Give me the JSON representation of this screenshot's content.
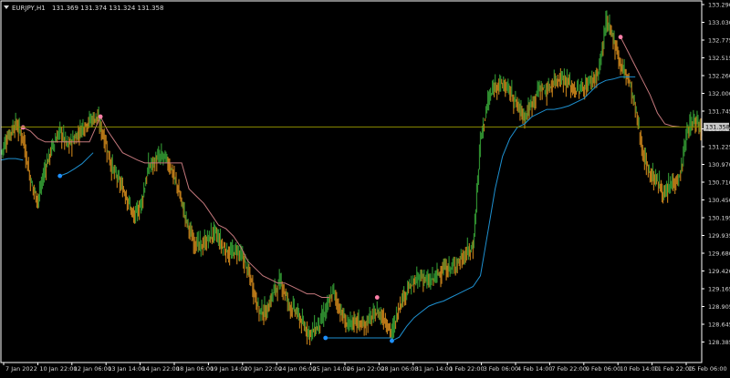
{
  "header": {
    "menu_icon": "triangle-down-icon",
    "symbol": "EURJPY,H1",
    "quote": "131.369 131.374 131.324 131.358"
  },
  "current_price_label": "131.358",
  "colors": {
    "background": "#000000",
    "frame": "#ffffff",
    "text": "#d8d8d8",
    "candle_up": "#2e8b2e",
    "candle_down": "#b87818",
    "upper_band": "#c4787c",
    "lower_band": "#1e90d0",
    "upper_marker": "#ff7fa8",
    "lower_marker": "#1e90ff",
    "price_line": "#8b8b00",
    "price_label_bg": "#c8c8c8"
  },
  "chart_data": {
    "type": "line",
    "title": "EURJPY,H1",
    "ylim": [
      128.1,
      133.1
    ],
    "grid": false,
    "y_ticks": [
      "133.290",
      "133.030",
      "132.775",
      "132.515",
      "132.260",
      "132.000",
      "131.745",
      "131.485",
      "131.225",
      "130.970",
      "130.710",
      "130.450",
      "130.195",
      "129.935",
      "129.680",
      "129.420",
      "129.165",
      "128.905",
      "128.645",
      "128.385"
    ],
    "x_ticks": [
      "7 Jan 2022",
      "10 Jan 22:00",
      "12 Jan 06:00",
      "13 Jan 14:00",
      "14 Jan 22:00",
      "18 Jan 06:00",
      "19 Jan 14:00",
      "20 Jan 22:00",
      "24 Jan 06:00",
      "25 Jan 14:00",
      "26 Jan 22:00",
      "28 Jan 06:00",
      "31 Jan 14:00",
      "1 Feb 22:00",
      "3 Feb 06:00",
      "4 Feb 14:00",
      "7 Feb 22:00",
      "9 Feb 06:00",
      "10 Feb 14:00",
      "11 Feb 22:00",
      "15 Feb 06:00"
    ],
    "current_price": 131.358,
    "series": [
      {
        "kind": "price",
        "points": [
          [
            0,
            131.0
          ],
          [
            2,
            131.25
          ],
          [
            4,
            131.4
          ],
          [
            6,
            131.2
          ],
          [
            8,
            130.6
          ],
          [
            10,
            130.35
          ],
          [
            12,
            130.8
          ],
          [
            14,
            131.1
          ],
          [
            16,
            131.3
          ],
          [
            18,
            131.1
          ],
          [
            20,
            131.2
          ],
          [
            22,
            131.35
          ],
          [
            24,
            131.45
          ],
          [
            26,
            131.5
          ],
          [
            28,
            131.2
          ],
          [
            30,
            130.8
          ],
          [
            32,
            130.6
          ],
          [
            34,
            130.4
          ],
          [
            36,
            130.1
          ],
          [
            38,
            130.3
          ],
          [
            40,
            130.8
          ],
          [
            42,
            130.9
          ],
          [
            44,
            130.95
          ],
          [
            46,
            130.8
          ],
          [
            48,
            130.5
          ],
          [
            50,
            130.1
          ],
          [
            52,
            129.8
          ],
          [
            54,
            129.7
          ],
          [
            56,
            129.8
          ],
          [
            58,
            129.9
          ],
          [
            60,
            129.7
          ],
          [
            62,
            129.6
          ],
          [
            64,
            129.65
          ],
          [
            66,
            129.5
          ],
          [
            68,
            129.2
          ],
          [
            70,
            128.8
          ],
          [
            72,
            128.8
          ],
          [
            74,
            129.1
          ],
          [
            76,
            129.2
          ],
          [
            78,
            128.9
          ],
          [
            80,
            128.8
          ],
          [
            82,
            128.6
          ],
          [
            84,
            128.5
          ],
          [
            86,
            128.6
          ],
          [
            88,
            128.8
          ],
          [
            90,
            129.1
          ],
          [
            92,
            128.8
          ],
          [
            94,
            128.6
          ],
          [
            96,
            128.7
          ],
          [
            98,
            128.6
          ],
          [
            100,
            128.7
          ],
          [
            102,
            128.8
          ],
          [
            104,
            128.7
          ],
          [
            106,
            128.5
          ],
          [
            108,
            128.9
          ],
          [
            110,
            129.1
          ],
          [
            112,
            129.2
          ],
          [
            114,
            129.3
          ],
          [
            116,
            129.2
          ],
          [
            118,
            129.3
          ],
          [
            120,
            129.4
          ],
          [
            122,
            129.4
          ],
          [
            124,
            129.5
          ],
          [
            126,
            129.6
          ],
          [
            128,
            129.7
          ],
          [
            130,
            131.2
          ],
          [
            132,
            131.7
          ],
          [
            134,
            131.95
          ],
          [
            136,
            131.95
          ],
          [
            138,
            131.85
          ],
          [
            140,
            131.65
          ],
          [
            142,
            131.5
          ],
          [
            144,
            131.7
          ],
          [
            146,
            131.9
          ],
          [
            148,
            131.85
          ],
          [
            150,
            132.0
          ],
          [
            152,
            132.05
          ],
          [
            154,
            131.95
          ],
          [
            156,
            131.85
          ],
          [
            158,
            131.9
          ],
          [
            160,
            132.0
          ],
          [
            162,
            132.1
          ],
          [
            164,
            132.8
          ],
          [
            166,
            132.6
          ],
          [
            168,
            132.2
          ],
          [
            170,
            132.05
          ],
          [
            172,
            131.6
          ],
          [
            174,
            131.0
          ],
          [
            176,
            130.7
          ],
          [
            178,
            130.6
          ],
          [
            180,
            130.4
          ],
          [
            182,
            130.6
          ],
          [
            184,
            130.65
          ],
          [
            186,
            131.3
          ],
          [
            188,
            131.45
          ],
          [
            190,
            131.36
          ]
        ]
      },
      {
        "name": "",
        "kind": "upper",
        "points": [
          [
            6,
            131.35
          ],
          [
            8,
            131.3
          ],
          [
            10,
            131.2
          ],
          [
            12,
            131.15
          ],
          [
            14,
            131.15
          ],
          [
            16,
            131.15
          ],
          [
            18,
            131.15
          ],
          [
            20,
            131.15
          ],
          [
            22,
            131.15
          ],
          [
            24,
            131.15
          ],
          [
            27,
            131.5
          ],
          [
            29,
            131.3
          ],
          [
            31,
            131.15
          ],
          [
            33,
            131.0
          ],
          [
            35,
            130.95
          ],
          [
            37,
            130.9
          ],
          [
            39,
            130.86
          ],
          [
            41,
            130.86
          ],
          [
            43,
            130.86
          ],
          [
            45,
            130.86
          ],
          [
            47,
            130.86
          ],
          [
            49,
            130.86
          ],
          [
            51,
            130.5
          ],
          [
            53,
            130.4
          ],
          [
            55,
            130.3
          ],
          [
            57,
            130.15
          ],
          [
            59,
            130.0
          ],
          [
            61,
            129.95
          ],
          [
            63,
            129.85
          ],
          [
            65,
            129.7
          ],
          [
            67,
            129.5
          ],
          [
            69,
            129.4
          ],
          [
            71,
            129.3
          ],
          [
            73,
            129.25
          ],
          [
            75,
            129.2
          ],
          [
            77,
            129.2
          ],
          [
            79,
            129.15
          ],
          [
            81,
            129.1
          ],
          [
            83,
            129.05
          ],
          [
            85,
            129.05
          ],
          [
            87,
            129.0
          ],
          [
            89,
            129.0
          ]
        ]
      },
      {
        "name": "",
        "kind": "upper",
        "points": [
          [
            168,
            132.6
          ],
          [
            170,
            132.4
          ],
          [
            172,
            132.2
          ],
          [
            174,
            132.0
          ],
          [
            176,
            131.8
          ],
          [
            178,
            131.55
          ],
          [
            180,
            131.4
          ],
          [
            182,
            131.37
          ],
          [
            184,
            131.36
          ]
        ]
      },
      {
        "name": "",
        "kind": "lower",
        "points": [
          [
            0,
            130.9
          ],
          [
            2,
            130.92
          ],
          [
            4,
            130.92
          ],
          [
            6,
            130.9
          ]
        ]
      },
      {
        "name": "",
        "kind": "lower",
        "points": [
          [
            16,
            130.68
          ],
          [
            18,
            130.72
          ],
          [
            20,
            130.78
          ],
          [
            22,
            130.85
          ],
          [
            24,
            130.95
          ],
          [
            25,
            131.0
          ]
        ]
      },
      {
        "name": "",
        "kind": "lower",
        "points": [
          [
            88,
            128.44
          ],
          [
            92,
            128.44
          ],
          [
            96,
            128.44
          ],
          [
            100,
            128.44
          ],
          [
            104,
            128.44
          ],
          [
            106,
            128.44
          ]
        ]
      },
      {
        "name": "",
        "kind": "lower",
        "points": [
          [
            106,
            128.4
          ],
          [
            108,
            128.45
          ],
          [
            110,
            128.6
          ],
          [
            112,
            128.72
          ],
          [
            114,
            128.8
          ],
          [
            116,
            128.88
          ],
          [
            118,
            128.92
          ],
          [
            120,
            128.95
          ],
          [
            122,
            129.0
          ],
          [
            124,
            129.05
          ],
          [
            126,
            129.1
          ],
          [
            128,
            129.15
          ],
          [
            130,
            129.3
          ],
          [
            132,
            129.9
          ],
          [
            134,
            130.5
          ],
          [
            136,
            130.95
          ],
          [
            138,
            131.2
          ],
          [
            140,
            131.35
          ],
          [
            142,
            131.4
          ],
          [
            144,
            131.5
          ],
          [
            146,
            131.55
          ],
          [
            148,
            131.6
          ],
          [
            150,
            131.6
          ],
          [
            152,
            131.62
          ],
          [
            154,
            131.65
          ],
          [
            156,
            131.7
          ],
          [
            158,
            131.75
          ],
          [
            160,
            131.85
          ],
          [
            162,
            131.95
          ],
          [
            164,
            132.0
          ],
          [
            166,
            132.02
          ],
          [
            168,
            132.05
          ],
          [
            170,
            132.05
          ],
          [
            172,
            132.05
          ]
        ]
      }
    ],
    "markers": [
      {
        "kind": "upper",
        "x": 6,
        "y": 131.35
      },
      {
        "kind": "upper",
        "x": 27,
        "y": 131.5
      },
      {
        "kind": "upper",
        "x": 102,
        "y": 129.0
      },
      {
        "kind": "upper",
        "x": 168,
        "y": 132.6
      },
      {
        "kind": "lower",
        "x": 16,
        "y": 130.68
      },
      {
        "kind": "lower",
        "x": 88,
        "y": 128.44
      },
      {
        "kind": "lower",
        "x": 106,
        "y": 128.4
      }
    ]
  }
}
